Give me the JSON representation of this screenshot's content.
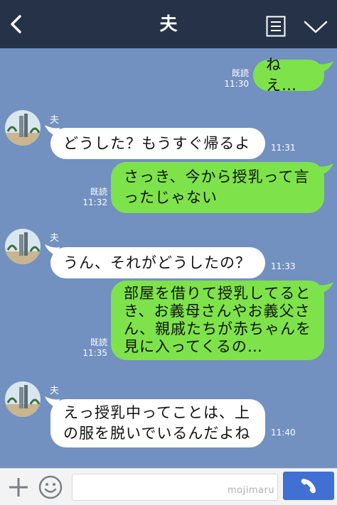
{
  "header": {
    "title": "夫",
    "back_icon": "chevron-left-icon",
    "menu_icon": "menu-list-icon",
    "dropdown_icon": "chevron-down-icon"
  },
  "colors": {
    "header_bg": "#253247",
    "chat_bg": "#7290c0",
    "my_bubble": "#7ee34a",
    "their_bubble": "#ffffff",
    "call_button": "#4170d4"
  },
  "messages": [
    {
      "from": "me",
      "text": "ねえ…",
      "read": "既読",
      "time": "11:30"
    },
    {
      "from": "them",
      "sender": "夫",
      "text": "どうした？もうすぐ帰るよ",
      "time": "11:31"
    },
    {
      "from": "me",
      "text": "さっき、今から授乳って言\nったじゃない",
      "read": "既読",
      "time": "11:32"
    },
    {
      "from": "them",
      "sender": "夫",
      "text": "うん、それがどうしたの？",
      "time": "11:33"
    },
    {
      "from": "me",
      "text": "部屋を借りて授乳してると\nき、お義母さんやお義父さ\nん、親戚たちが赤ちゃんを\n見に入ってくるの…",
      "read": "既読",
      "time": "11:35"
    },
    {
      "from": "them",
      "sender": "夫",
      "text": "えっ授乳中ってことは、上\nの服を脱いでいるんだよね",
      "time": "11:40"
    }
  ],
  "input": {
    "placeholder": "",
    "watermark": "mojimaru",
    "plus_icon": "plus-icon",
    "emoji_icon": "smile-icon",
    "call_icon": "phone-icon"
  }
}
